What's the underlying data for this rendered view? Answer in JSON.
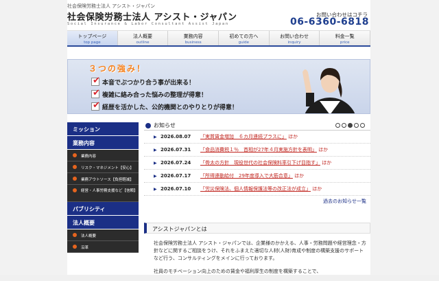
{
  "header": {
    "tagline": "社会保険労務士法人 アシスト・ジャパン",
    "logo": "社会保険労務士法人 アシスト・ジャパン",
    "logo_sub": "Social Insurance & Labor Consultant Assist Japan",
    "contact_label": "お問い合わせはコチラ",
    "phone": "06-6360-6818"
  },
  "nav": [
    {
      "jp": "トップページ",
      "en": "top page"
    },
    {
      "jp": "法人概要",
      "en": "outline"
    },
    {
      "jp": "業務内容",
      "en": "business"
    },
    {
      "jp": "初めての方へ",
      "en": "guide"
    },
    {
      "jp": "お問い合わせ",
      "en": "inquiry"
    },
    {
      "jp": "料金一覧",
      "en": "price"
    }
  ],
  "hero": {
    "title": "３つの強み！",
    "lines": [
      "本音でぶつかり合う事が出来る！",
      "複雑に絡み合った悩みの整理が得意！",
      "経歴を活かした、公的機関とのやりとりが得意！"
    ]
  },
  "sidebar": {
    "mission": "ミッション",
    "business": "業務内容",
    "items": [
      "業務内容",
      "リスク・マネジメント【安心】",
      "業務アウトソース【負担軽減】",
      "経営・人事労務支援など【信頼】"
    ],
    "publicity": "パブリシティ",
    "corporate": "法人概要",
    "corp_items": [
      "法人概要",
      "沿革"
    ]
  },
  "news": {
    "title": "お知らせ",
    "more": "過去のお知らせ一覧",
    "items": [
      {
        "date": "2026.08.07",
        "text": "「実質賃金増加　６カ月連続プラスに」",
        "suffix": "ほか"
      },
      {
        "date": "2026.07.31",
        "text": "「食品消費税１％　首相が27年４月実施方針を表明」",
        "suffix": "ほか"
      },
      {
        "date": "2026.07.24",
        "text": "「骨太の方針　現役世代の社会保険料率引下げ目指す」",
        "suffix": "ほか"
      },
      {
        "date": "2026.07.17",
        "text": "「所得連動給付　29年度導入で大筋合意」",
        "suffix": "ほか"
      },
      {
        "date": "2026.07.10",
        "text": "「労災保険法、個人情報保護法等の改正法が成立」",
        "suffix": "ほか"
      }
    ]
  },
  "about": {
    "title": "アシストジャパンとは",
    "p1": "社会保険労務士法人 アシスト・ジャパンでは、企業様のかかえる、人事・労務問題や経営理念・方針などに関するご相談をうけ、それをふまえた適切な人材(人財)育成や制度の構築支援のサポートなど行う、コンサルティングをメインに行っております。",
    "p2": "社員のモチベーション向上のための賃金や福利厚生の制度を構築することで、"
  },
  "colors": {
    "brand": "#1b2f86",
    "accent": "#f5821f",
    "news_link": "#c0241e"
  }
}
